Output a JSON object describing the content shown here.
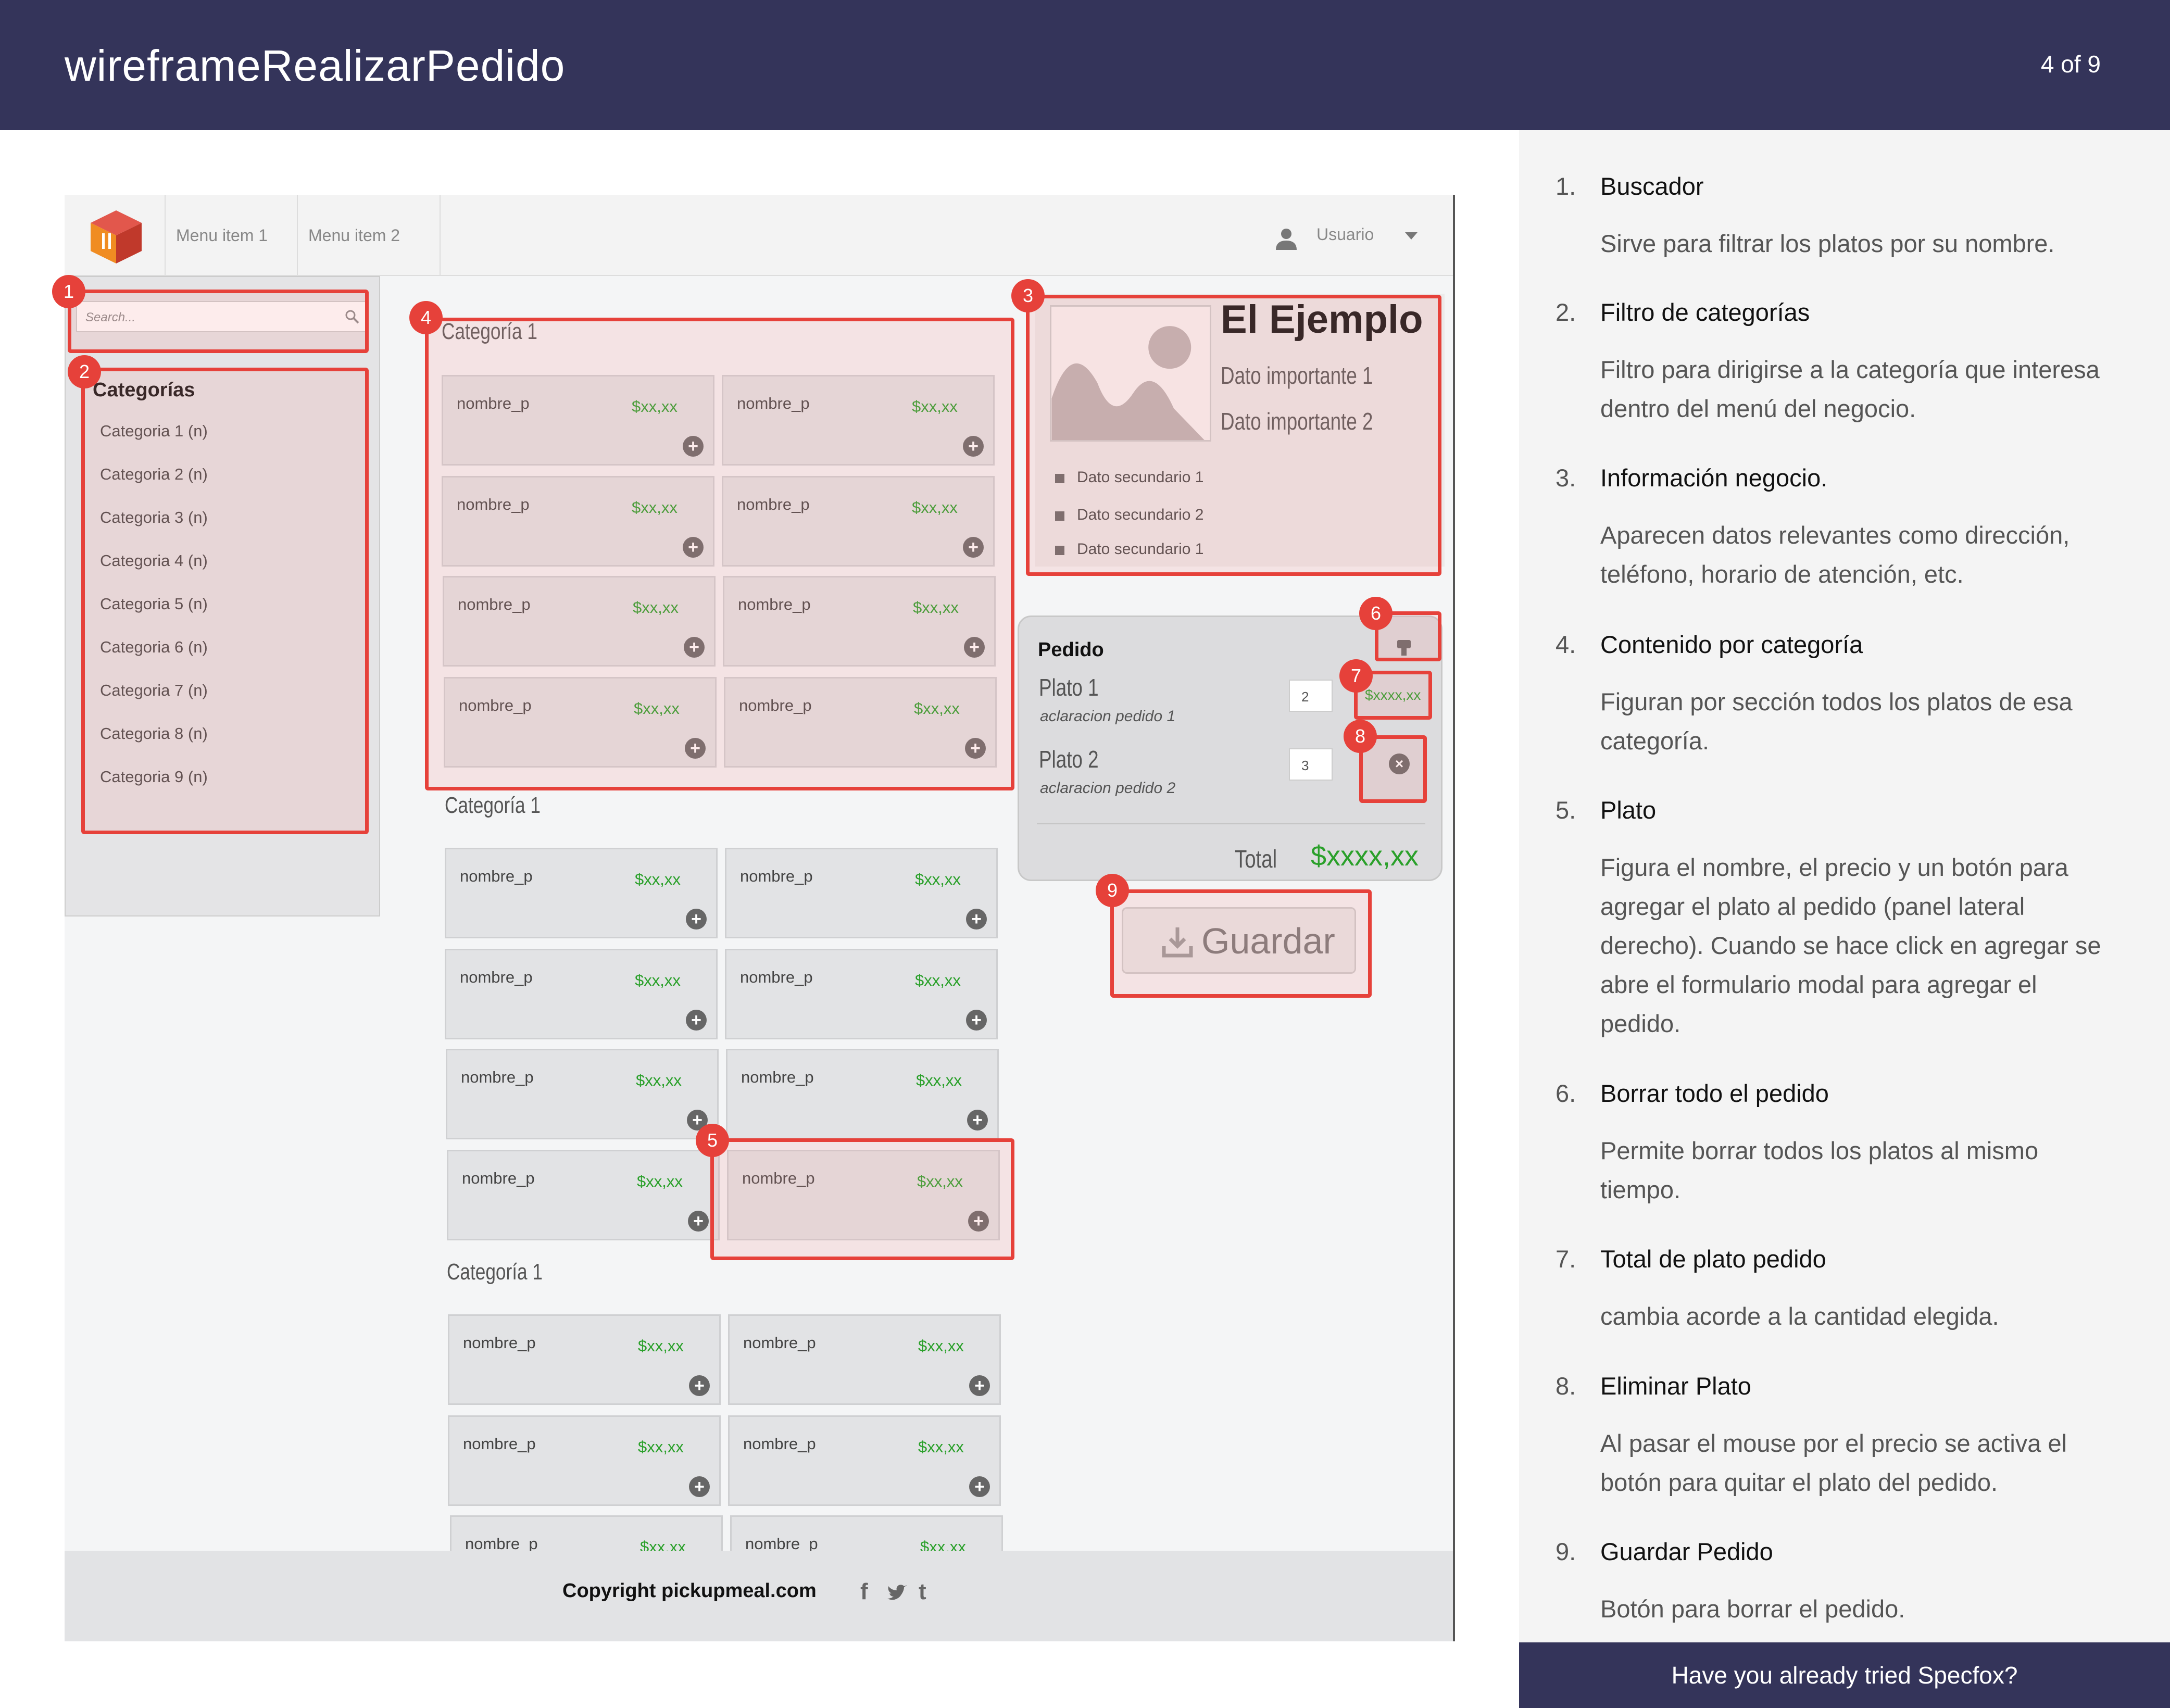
{
  "header": {
    "title": "wireframeRealizarPedido",
    "page": "4 of 9"
  },
  "wireframe": {
    "nav": {
      "menu_item_1": "Menu item 1",
      "menu_item_2": "Menu item 2",
      "user": "Usuario"
    },
    "search_placeholder": "Search...",
    "categories_title": "Categorías",
    "categories": [
      "Categoria 1 (n)",
      "Categoria 2 (n)",
      "Categoria 3 (n)",
      "Categoria 4 (n)",
      "Categoria 5 (n)",
      "Categoria 6 (n)",
      "Categoria 7 (n)",
      "Categoria 8 (n)",
      "Categoria 9 (n)"
    ],
    "category_label": "Categoría 1",
    "dish_name": "nombre_p",
    "dish_price": "$xx,xx",
    "business": {
      "name": "El Ejemplo",
      "important_1": "Dato importante 1",
      "important_2": "Dato importante 2",
      "secondary": [
        "Dato secundario 1",
        "Dato secundario 2",
        "Dato secundario 1"
      ]
    },
    "order": {
      "title": "Pedido",
      "items": [
        {
          "name": "Plato 1",
          "note": "aclaracion pedido 1",
          "qty": "2",
          "price": "$xxxx,xx"
        },
        {
          "name": "Plato 2",
          "note": "aclaracion pedido 2",
          "qty": "3"
        }
      ],
      "total_label": "Total",
      "total_value": "$xxxx,xx",
      "save_label": "Guardar"
    },
    "footer": {
      "copyright": "Copyright pickupmeal.com"
    }
  },
  "annotations": [
    {
      "num": "1.",
      "title": "Buscador",
      "desc": "Sirve para filtrar los platos por su nombre."
    },
    {
      "num": "2.",
      "title": "Filtro de categorías",
      "desc": "Filtro para dirigirse a la categoría que interesa dentro del menú del negocio."
    },
    {
      "num": "3.",
      "title": "Información negocio.",
      "desc": "Aparecen datos relevantes como dirección, teléfono, horario de atención, etc."
    },
    {
      "num": "4.",
      "title": "Contenido por categoría",
      "desc": "Figuran por sección todos los platos de esa categoría."
    },
    {
      "num": "5.",
      "title": "Plato",
      "desc": "Figura el nombre, el precio y un botón para agregar el plato al pedido (panel lateral derecho). Cuando se hace click en agregar se abre el formulario modal para agregar el pedido."
    },
    {
      "num": "6.",
      "title": "Borrar todo el pedido",
      "desc": "Permite borrar todos los platos al mismo tiempo."
    },
    {
      "num": "7.",
      "title": "Total de plato pedido",
      "desc": "cambia acorde a la cantidad elegida."
    },
    {
      "num": "8.",
      "title": "Eliminar Plato",
      "desc": "Al pasar el mouse por el precio se activa el botón para quitar el plato del pedido."
    },
    {
      "num": "9.",
      "title": "Guardar Pedido",
      "desc": "Botón para borrar el pedido."
    }
  ],
  "badges": [
    "1",
    "2",
    "3",
    "4",
    "5",
    "6",
    "7",
    "8",
    "9"
  ],
  "promo": "Have you already tried Specfox?",
  "colors": {
    "header_bg": "#34345a",
    "annotation_red": "#e6413a",
    "price_green": "#2aa02a"
  }
}
